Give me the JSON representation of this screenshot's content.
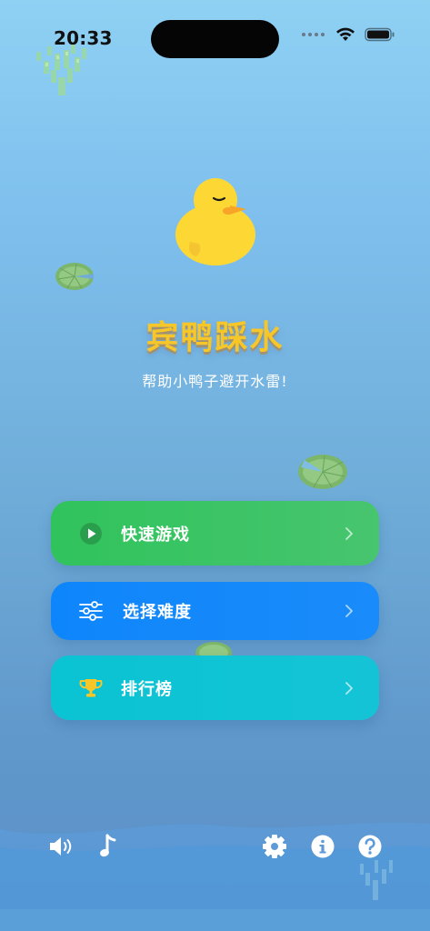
{
  "status_bar": {
    "time": "20:33"
  },
  "app": {
    "title": "宾鸭踩水",
    "subtitle": "帮助小鸭子避开水雷!"
  },
  "menu": [
    {
      "label": "快速游戏",
      "icon": "play-icon",
      "color": "#34c759"
    },
    {
      "label": "选择难度",
      "icon": "sliders-icon",
      "color": "#0a84ff"
    },
    {
      "label": "排行榜",
      "icon": "trophy-icon",
      "color": "#0cc3d3"
    }
  ],
  "bottom_bar": {
    "icons": [
      "speaker-icon",
      "music-note-icon",
      "gear-icon",
      "info-icon",
      "help-icon"
    ]
  },
  "colors": {
    "title": "#f7c629",
    "duck": "#fdd835",
    "beak": "#f7a428"
  }
}
